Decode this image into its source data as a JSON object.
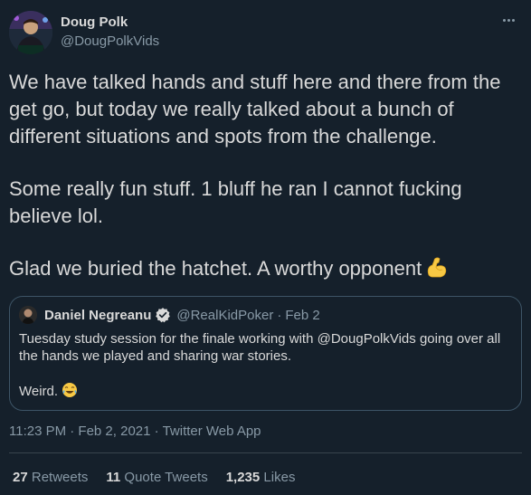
{
  "author": {
    "name": "Doug Polk",
    "handle": "@DougPolkVids"
  },
  "tweet": {
    "paragraphs": [
      "We have talked hands and stuff here and there from the get go, but today we really talked about a bunch of different situations and spots from the challenge.",
      "Some really fun stuff. 1 bluff he ran I cannot fucking believe lol.",
      "Glad we buried the hatchet. A worthy opponent"
    ],
    "emoji": "flexed-biceps-icon"
  },
  "quote": {
    "name": "Daniel Negreanu",
    "handle": "@RealKidPoker",
    "separator": "·",
    "date": "Feb 2",
    "body_line": "Tuesday study session for the finale working with @DougPolkVids going over all the hands we played and sharing war stories.",
    "body_line2": "Weird.",
    "emoji": "laughing-tears-icon"
  },
  "meta": {
    "time": "11:23 PM · Feb 2, 2021",
    "separator": "·",
    "source": "Twitter Web App"
  },
  "stats": {
    "retweets_count": "27",
    "retweets_label": "Retweets",
    "quotes_count": "11",
    "quotes_label": "Quote Tweets",
    "likes_count": "1,235",
    "likes_label": "Likes"
  },
  "colors": {
    "background": "#15202b",
    "text": "#d9d9d9",
    "secondary": "#8899a6",
    "border": "#38444d",
    "verified": "#d9d9d9"
  }
}
